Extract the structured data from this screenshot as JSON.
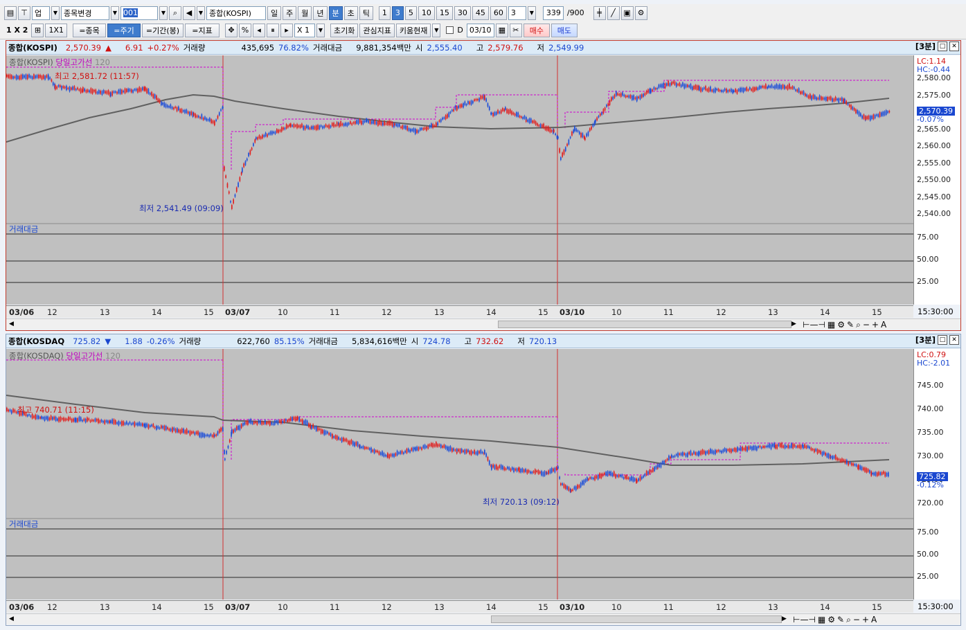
{
  "toolbar1": {
    "market_combo": "업",
    "change_btn": "종목변경",
    "code_value": "001",
    "name_value": "종합(KOSPI)",
    "period_tabs": [
      "일",
      "주",
      "월",
      "년",
      "분",
      "초",
      "틱"
    ],
    "selected_period": "분",
    "intervals": [
      "1",
      "3",
      "5",
      "10",
      "15",
      "30",
      "45",
      "60"
    ],
    "selected_interval": "3",
    "interval_combo": "3",
    "count_value": "339",
    "count_max": "/900"
  },
  "toolbar2": {
    "layout": "1 X 2",
    "layout_1x1": "1X1",
    "btn_stock": "=종목",
    "btn_period": "=주기",
    "btn_range": "=기간(봉)",
    "btn_indicator": "=지표",
    "pct": "%",
    "zoom": "X 1",
    "reset": "초기화",
    "favorites": "관심지표",
    "kiwoom": "키움현재",
    "d_label": "D",
    "date_value": "03/10",
    "buy": "매수",
    "sell": "매도"
  },
  "panel1": {
    "name": "종합(KOSPI)",
    "price": "2,570.39",
    "dir": "▲",
    "change": "6.91",
    "change_pct": "+0.27%",
    "vol_label": "거래량",
    "volume": "435,695",
    "vol_pct": "76.82%",
    "amt_label": "거래대금",
    "amount": "9,881,354백만",
    "open_label": "시",
    "open": "2,555.40",
    "high_label": "고",
    "high": "2,579.76",
    "low_label": "저",
    "low": "2,549.99",
    "period": "[3분]",
    "legend_name": "종합(KOSPI)",
    "legend_line": "당일고가선",
    "legend_n": "120",
    "lc": "LC:1.14",
    "hc": "HC:-0.44",
    "yticks": [
      "2,580.00",
      "2,575.00",
      "2,570.00",
      "2,565.00",
      "2,560.00",
      "2,555.00",
      "2,550.00",
      "2,545.00",
      "2,540.00"
    ],
    "cur_price": "2,570.39",
    "cur_pct": "-0.07%",
    "max_ann": "최고 2,581.72 (11:57)",
    "min_ann": "최저 2,541.49 (09:09)",
    "sub_legend": "거래대금",
    "sub_ticks": [
      "75.00",
      "50.00",
      "25.00"
    ],
    "xticks": [
      "03/06",
      "12",
      "13",
      "14",
      "15",
      "03/07",
      "10",
      "11",
      "12",
      "13",
      "14",
      "15",
      "03/10",
      "10",
      "11",
      "12",
      "13",
      "14",
      "15"
    ],
    "xend": "15:30:00"
  },
  "panel2": {
    "name": "종합(KOSDAQ",
    "price": "725.82",
    "dir": "▼",
    "change": "1.88",
    "change_pct": "-0.26%",
    "vol_label": "거래량",
    "volume": "622,760",
    "vol_pct": "85.15%",
    "amt_label": "거래대금",
    "amount": "5,834,616백만",
    "open_label": "시",
    "open": "724.78",
    "high_label": "고",
    "high": "732.62",
    "low_label": "저",
    "low": "720.13",
    "period": "[3분]",
    "legend_name": "종합(KOSDAQ)",
    "legend_line": "당일고가선",
    "legend_n": "120",
    "lc": "LC:0.79",
    "hc": "HC:-2.01",
    "yticks": [
      "745.00",
      "740.00",
      "735.00",
      "730.00",
      "725.00",
      "720.00"
    ],
    "cur_price": "725.82",
    "cur_pct": "-0.12%",
    "max_ann": "최고 740.71 (11:15)",
    "min_ann": "최저 720.13 (09:12)",
    "sub_legend": "거래대금",
    "sub_ticks": [
      "75.00",
      "50.00",
      "25.00"
    ],
    "xticks": [
      "03/06",
      "12",
      "13",
      "14",
      "15",
      "03/07",
      "10",
      "11",
      "12",
      "13",
      "14",
      "15",
      "03/10",
      "10",
      "11",
      "12",
      "13",
      "14",
      "15"
    ],
    "xend": "15:30:00"
  },
  "colors": {
    "up": "#e02020",
    "down": "#1f4fd8",
    "ma": "#606060",
    "highline": "#d000d0",
    "divider": "#d23030"
  }
}
